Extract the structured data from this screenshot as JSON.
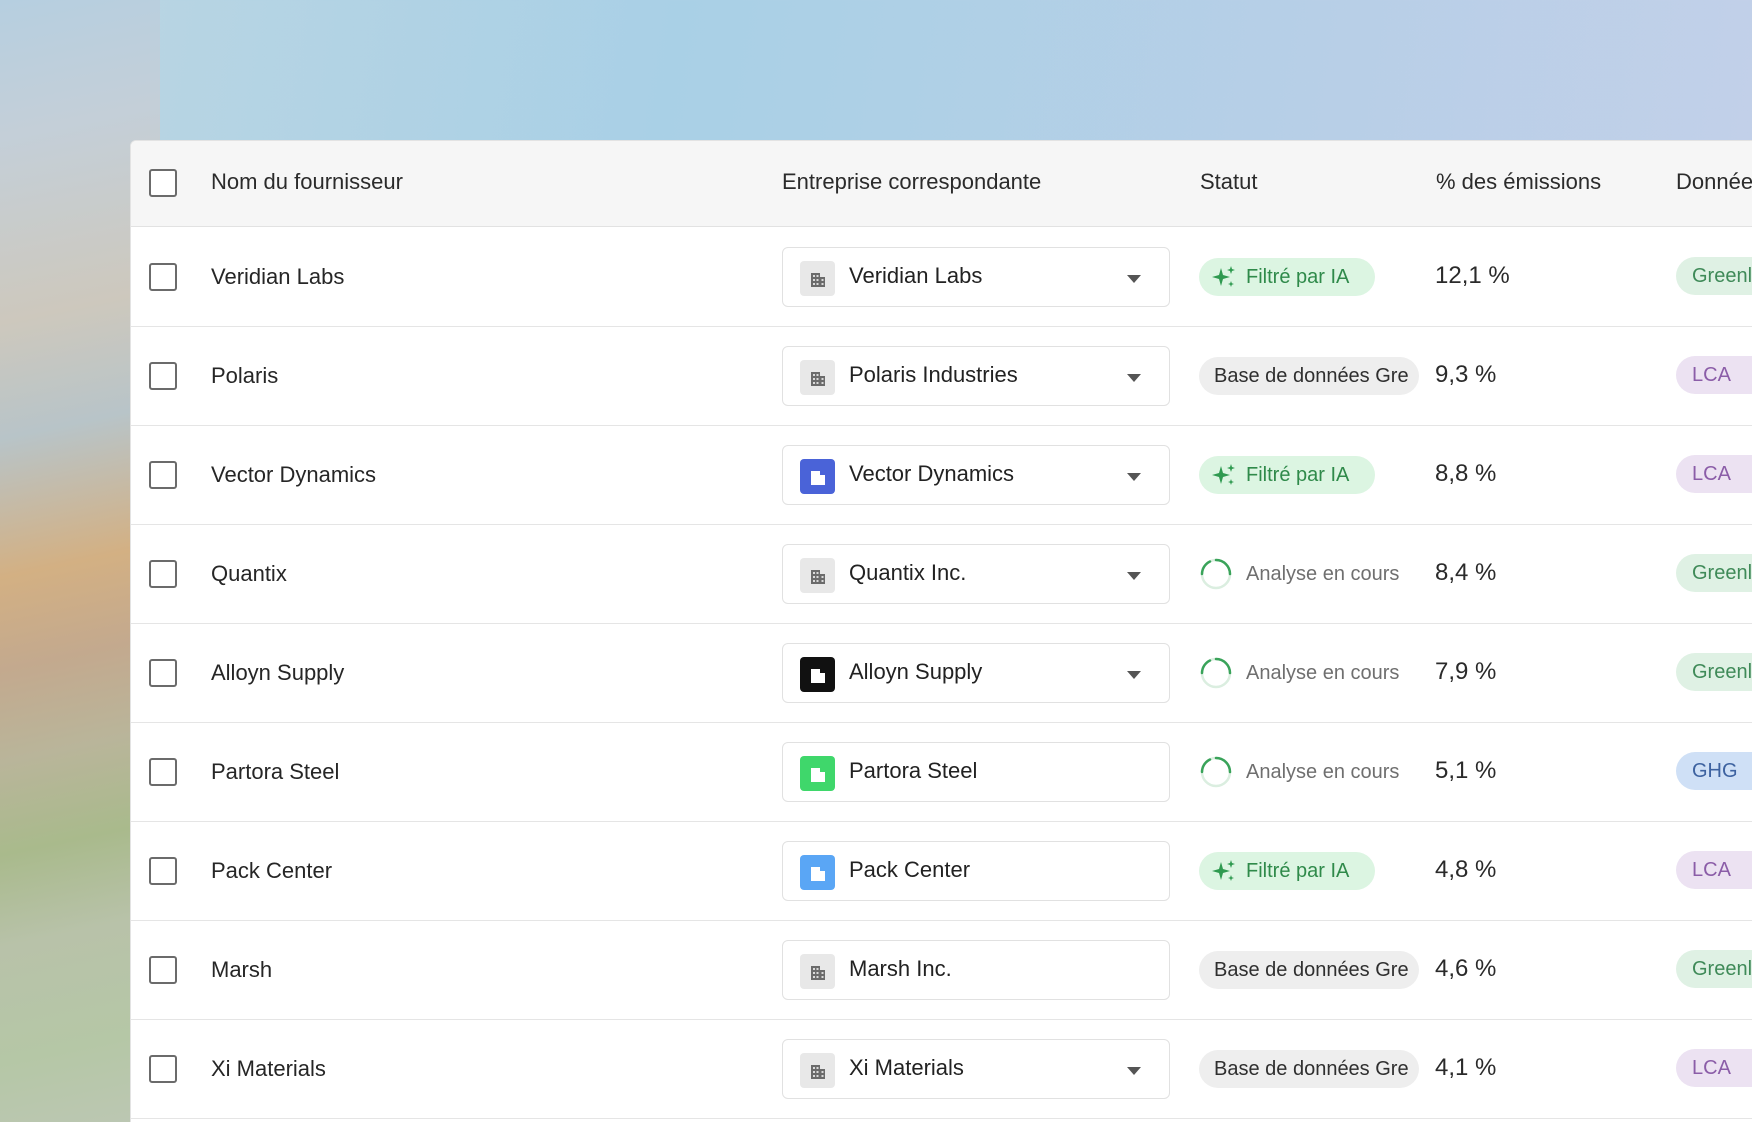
{
  "table": {
    "headers": {
      "supplier_name": "Nom du fournisseur",
      "matching_company": "Entreprise correspondante",
      "status": "Statut",
      "emissions_pct": "% des émissions",
      "data": "Donnée"
    },
    "rows": [
      {
        "supplier": "Veridian Labs",
        "company": "Veridian Labs",
        "company_icon_color": "#e8e8e8",
        "company_icon_glyph_color": "#6b6b6b",
        "has_dropdown": true,
        "status_kind": "ai",
        "status": "Filtré par IA",
        "pct": "12,1 %",
        "source": "Greenl",
        "source_kind": "green"
      },
      {
        "supplier": "Polaris",
        "company": "Polaris Industries",
        "company_icon_color": "#e8e8e8",
        "company_icon_glyph_color": "#6b6b6b",
        "has_dropdown": true,
        "status_kind": "db",
        "status": "Base de données Gre",
        "pct": "9,3 %",
        "source": "LCA",
        "source_kind": "lca"
      },
      {
        "supplier": "Vector Dynamics",
        "company": "Vector Dynamics",
        "company_icon_color": "#4a63d8",
        "company_icon_glyph_color": "#ffffff",
        "has_dropdown": true,
        "status_kind": "ai",
        "status": "Filtré par IA",
        "pct": "8,8 %",
        "source": "LCA",
        "source_kind": "lca"
      },
      {
        "supplier": "Quantix",
        "company": "Quantix Inc.",
        "company_icon_color": "#e8e8e8",
        "company_icon_glyph_color": "#6b6b6b",
        "has_dropdown": true,
        "status_kind": "an",
        "status": "Analyse en cours",
        "pct": "8,4 %",
        "source": "Greenl",
        "source_kind": "green"
      },
      {
        "supplier": "Alloyn Supply",
        "company": "Alloyn Supply",
        "company_icon_color": "#111111",
        "company_icon_glyph_color": "#ffffff",
        "has_dropdown": true,
        "status_kind": "an",
        "status": "Analyse en cours",
        "pct": "7,9 %",
        "source": "Greenl",
        "source_kind": "green"
      },
      {
        "supplier": "Partora Steel",
        "company": "Partora Steel",
        "company_icon_color": "#3fd76b",
        "company_icon_glyph_color": "#ffffff",
        "has_dropdown": false,
        "status_kind": "an",
        "status": "Analyse en cours",
        "pct": "5,1 %",
        "source": "GHG",
        "source_kind": "ghg"
      },
      {
        "supplier": "Pack Center",
        "company": "Pack Center",
        "company_icon_color": "#5aa6f5",
        "company_icon_glyph_color": "#ffffff",
        "has_dropdown": false,
        "status_kind": "ai",
        "status": "Filtré par IA",
        "pct": "4,8 %",
        "source": "LCA",
        "source_kind": "lca"
      },
      {
        "supplier": "Marsh",
        "company": "Marsh Inc.",
        "company_icon_color": "#e8e8e8",
        "company_icon_glyph_color": "#6b6b6b",
        "has_dropdown": false,
        "status_kind": "db",
        "status": "Base de données Gre",
        "pct": "4,6 %",
        "source": "Greenl",
        "source_kind": "green"
      },
      {
        "supplier": "Xi Materials",
        "company": "Xi Materials",
        "company_icon_color": "#e8e8e8",
        "company_icon_glyph_color": "#6b6b6b",
        "has_dropdown": true,
        "status_kind": "db",
        "status": "Base de données Gre",
        "pct": "4,1 %",
        "source": "LCA",
        "source_kind": "lca"
      }
    ]
  },
  "icons": {
    "company": "building-icon",
    "ai_status": "sparkle-icon",
    "analysis_status": "loading-spinner-icon",
    "dropdown": "chevron-down-icon"
  },
  "colors": {
    "ai_status_bg": "#dcf5e2",
    "ai_status_fg": "#2f8a4a",
    "db_status_bg": "#eeeeee",
    "spinner": "#3aa35a",
    "tag_green_bg": "#dff1e4",
    "tag_lca_bg": "#ece2f2",
    "tag_ghg_bg": "#cfe0f6"
  }
}
